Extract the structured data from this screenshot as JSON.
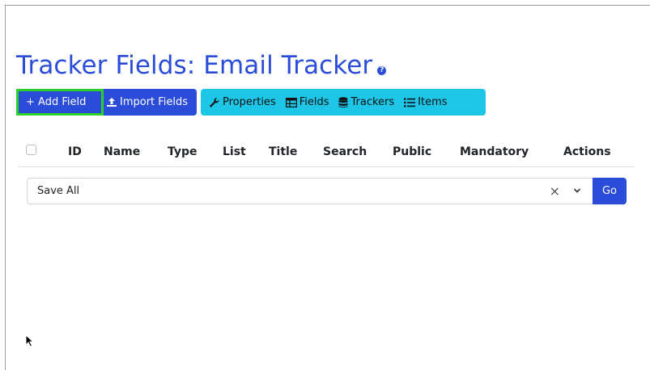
{
  "page": {
    "title": "Tracker Fields: Email Tracker",
    "help_icon": "question-circle-icon"
  },
  "toolbar": {
    "add_field_label": "+ Add Field",
    "import_fields_label": "Import Fields",
    "properties_label": "Properties",
    "fields_label": "Fields",
    "trackers_label": "Trackers",
    "items_label": "Items"
  },
  "table": {
    "columns": [
      "ID",
      "Name",
      "Type",
      "List",
      "Title",
      "Search",
      "Public",
      "Mandatory",
      "Actions"
    ]
  },
  "bulk_action": {
    "selected": "Save All",
    "clear": "×",
    "go_label": "Go"
  },
  "colors": {
    "primary": "#2a4cd8",
    "info": "#1dc6e6",
    "highlight": "#2bd02b"
  }
}
